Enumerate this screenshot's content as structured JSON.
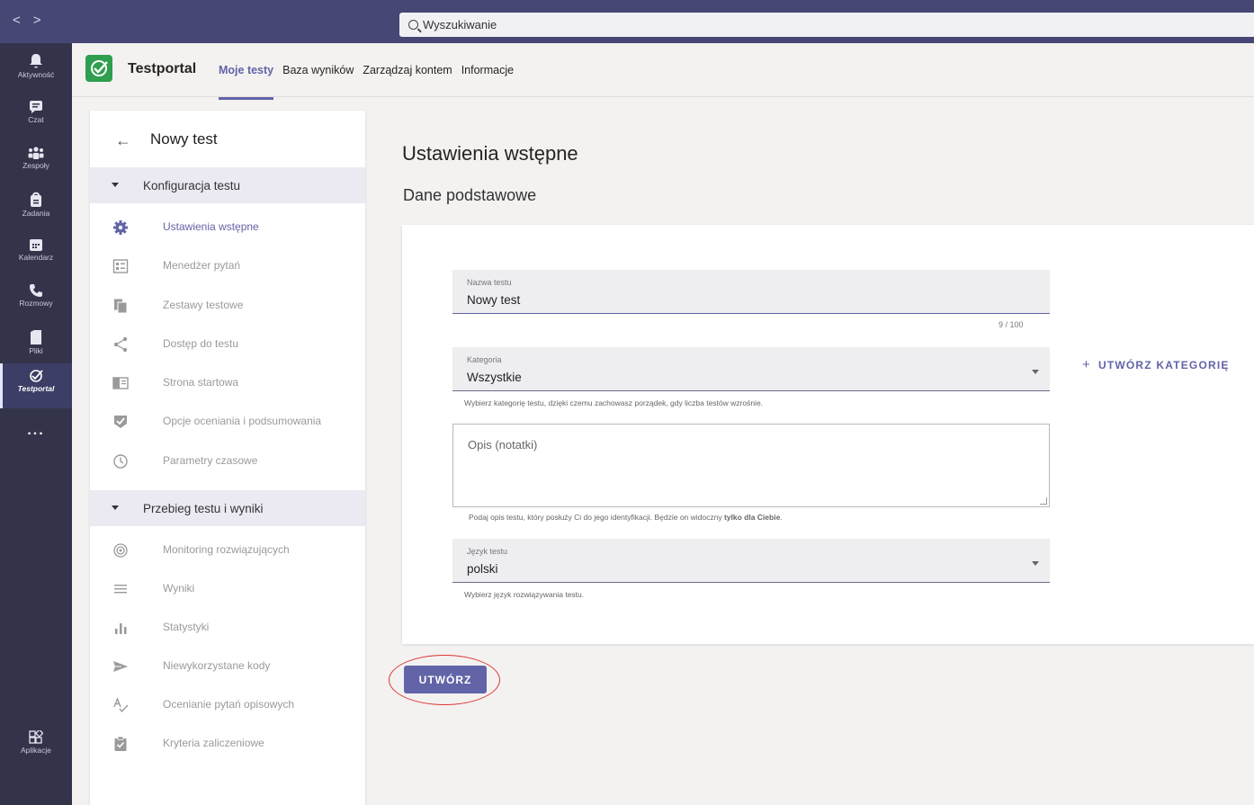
{
  "topbar": {
    "back": "<",
    "forward": ">",
    "search_placeholder": "Wyszukiwanie"
  },
  "rail": {
    "items": [
      {
        "label": "Aktywność",
        "icon": "bell-icon"
      },
      {
        "label": "Czat",
        "icon": "chat-icon"
      },
      {
        "label": "Zespoły",
        "icon": "teams-icon"
      },
      {
        "label": "Zadania",
        "icon": "assignments-icon"
      },
      {
        "label": "Kalendarz",
        "icon": "calendar-icon"
      },
      {
        "label": "Rozmowy",
        "icon": "phone-icon"
      },
      {
        "label": "Pliki",
        "icon": "file-icon"
      },
      {
        "label": "Testportal",
        "icon": "testportal-icon"
      }
    ],
    "more": "...",
    "apps": "Aplikacje"
  },
  "header": {
    "app_name": "Testportal",
    "tabs": [
      "Moje testy",
      "Baza wyników",
      "Zarządzaj kontem",
      "Informacje"
    ]
  },
  "sidebar": {
    "title": "Nowy test",
    "section1": "Konfiguracja testu",
    "items1": [
      "Ustawienia wstępne",
      "Menedżer pytań",
      "Zestawy testowe",
      "Dostęp do testu",
      "Strona startowa",
      "Opcje oceniania i podsumowania",
      "Parametry czasowe"
    ],
    "section2": "Przebieg testu i wyniki",
    "items2": [
      "Monitoring rozwiązujących",
      "Wyniki",
      "Statystyki",
      "Niewykorzystane kody",
      "Ocenianie pytań opisowych",
      "Kryteria zaliczeniowe"
    ]
  },
  "main": {
    "title": "Ustawienia wstępne",
    "subtitle": "Dane podstawowe",
    "name_label": "Nazwa testu",
    "name_value": "Nowy test",
    "name_counter": "9 / 100",
    "category_label": "Kategoria",
    "category_value": "Wszystkie",
    "category_hint": "Wybierz kategorię testu, dzięki czemu zachowasz porządek, gdy liczba testów wzrośnie.",
    "create_category": "UTWÓRZ KATEGORIĘ",
    "description_placeholder": "Opis (notatki)",
    "description_hint_pre": "Podaj opis testu, który posłuży Ci do jego identyfikacji. Będzie on widoczny ",
    "description_hint_bold": "tylko dla Ciebie",
    "description_hint_post": ".",
    "language_label": "Język testu",
    "language_value": "polski",
    "language_hint": "Wybierz język rozwiązywania testu.",
    "create_button": "UTWÓRZ"
  }
}
